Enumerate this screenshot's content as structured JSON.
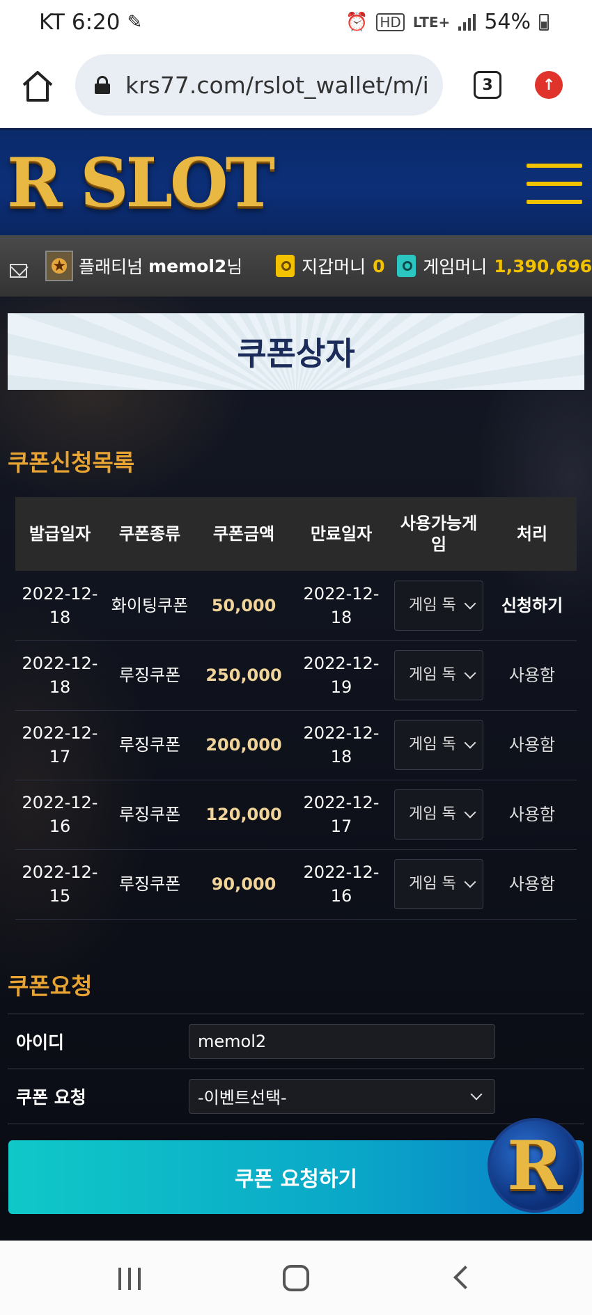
{
  "status_bar": {
    "carrier": "KT",
    "time": "6:20",
    "hd": "HD",
    "network": "LTE+",
    "battery": "54%"
  },
  "browser": {
    "url": "krs77.com/rslot_wallet/m/i",
    "tab_count": "3"
  },
  "site": {
    "logo": "R SLOT"
  },
  "user_bar": {
    "rank": "플래티넘",
    "username": "memol2",
    "suffix": "님",
    "wallet_label": "지갑머니",
    "wallet_value": "0",
    "game_label": "게임머니",
    "game_value": "1,390,696"
  },
  "page_title": "쿠폰상자",
  "coupon_list": {
    "title": "쿠폰신청목록",
    "headers": [
      "발급일자",
      "쿠폰종류",
      "쿠폰금액",
      "만료일자",
      "사용가능게임",
      "처리"
    ],
    "rows": [
      {
        "issued": "2022-12-18",
        "type": "화이팅쿠폰",
        "amount": "50,000",
        "expires": "2022-12-18",
        "game": "게임 독",
        "action": "신청하기"
      },
      {
        "issued": "2022-12-18",
        "type": "루징쿠폰",
        "amount": "250,000",
        "expires": "2022-12-19",
        "game": "게임 독",
        "action": "사용함"
      },
      {
        "issued": "2022-12-17",
        "type": "루징쿠폰",
        "amount": "200,000",
        "expires": "2022-12-18",
        "game": "게임 독",
        "action": "사용함"
      },
      {
        "issued": "2022-12-16",
        "type": "루징쿠폰",
        "amount": "120,000",
        "expires": "2022-12-17",
        "game": "게임 독",
        "action": "사용함"
      },
      {
        "issued": "2022-12-15",
        "type": "루징쿠폰",
        "amount": "90,000",
        "expires": "2022-12-16",
        "game": "게임 독",
        "action": "사용함"
      }
    ]
  },
  "coupon_request": {
    "title": "쿠폰요청",
    "id_label": "아이디",
    "id_value": "memol2",
    "request_label": "쿠폰 요청",
    "request_value": "-이벤트선택-",
    "submit_label": "쿠폰 요청하기"
  },
  "fab": {
    "label": "R"
  },
  "colors": {
    "accent_gold": "#e8a432",
    "header_blue": "#0c2f78",
    "button_teal": "#10c8c8"
  }
}
